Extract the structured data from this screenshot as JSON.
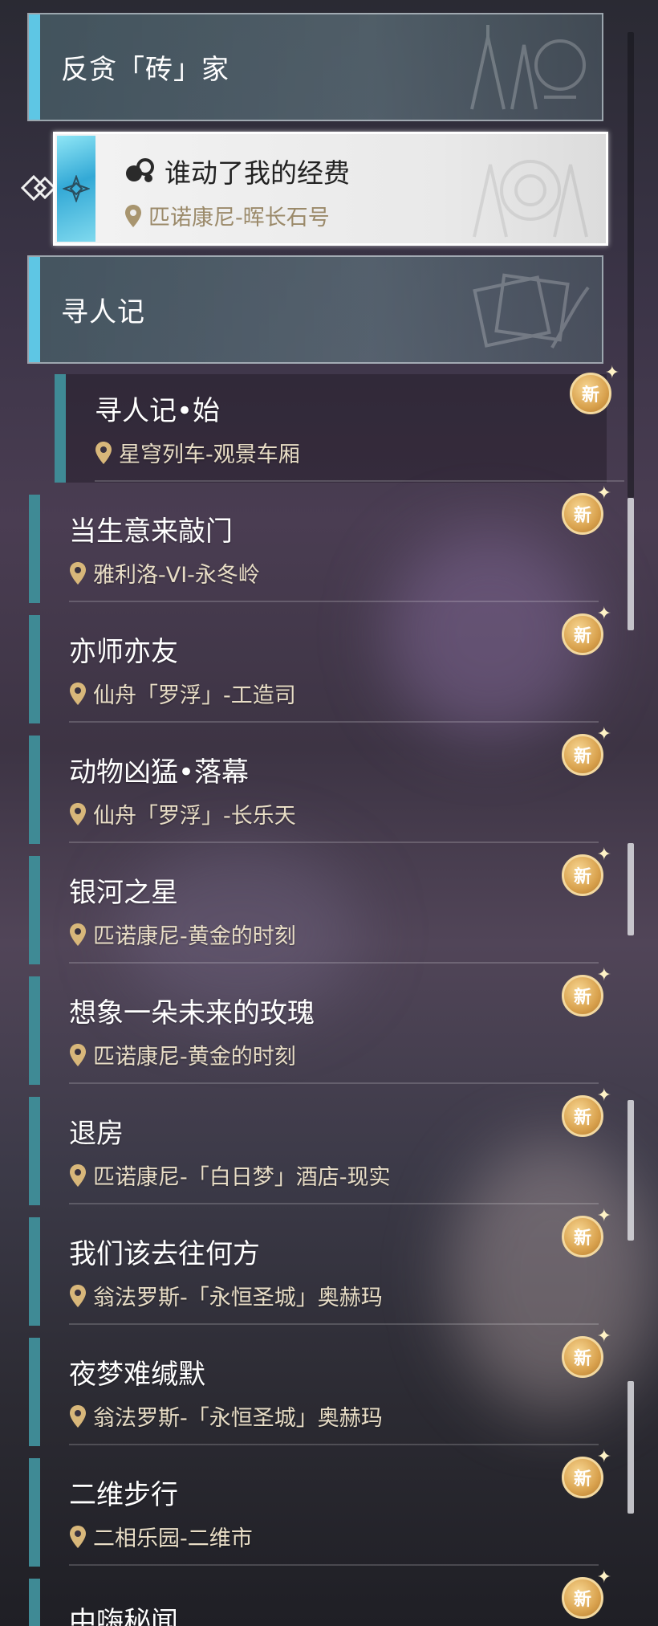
{
  "categories": [
    {
      "label": "反贪「砖」家"
    },
    {
      "label": "寻人记"
    }
  ],
  "selected_quest": {
    "title": "谁动了我的经费",
    "location": "匹诺康尼-晖长石号"
  },
  "quests": [
    {
      "title": "寻人记•始",
      "location": "星穹列车-观景车厢",
      "badge": "新"
    },
    {
      "title": "当生意来敲门",
      "location": "雅利洛-VI-永冬岭",
      "badge": "新"
    },
    {
      "title": "亦师亦友",
      "location": "仙舟「罗浮」-工造司",
      "badge": "新"
    },
    {
      "title": "动物凶猛•落幕",
      "location": "仙舟「罗浮」-长乐天",
      "badge": "新"
    },
    {
      "title": "银河之星",
      "location": "匹诺康尼-黄金的时刻",
      "badge": "新"
    },
    {
      "title": "想象一朵未来的玫瑰",
      "location": "匹诺康尼-黄金的时刻",
      "badge": "新"
    },
    {
      "title": "退房",
      "location": "匹诺康尼-「白日梦」酒店-现实",
      "badge": "新"
    },
    {
      "title": "我们该去往何方",
      "location": "翁法罗斯-「永恒圣城」奥赫玛",
      "badge": "新"
    },
    {
      "title": "夜梦难缄默",
      "location": "翁法罗斯-「永恒圣城」奥赫玛",
      "badge": "新"
    },
    {
      "title": "二维步行",
      "location": "二相乐园-二维市",
      "badge": "新"
    },
    {
      "title": "中嗨秘闻",
      "location": "",
      "badge": "新"
    }
  ],
  "icons": {
    "location": "map-pin-icon",
    "quest_type": "companion-quest-icon",
    "selection": "diamond-pointer-icon",
    "new_badge": "new-badge-icon"
  },
  "colors": {
    "category_accent": "#5ec6e4",
    "quest_bar": "#3f8a95",
    "badge_gold": "#d9a24e",
    "location_text": "#e8ddc6"
  }
}
